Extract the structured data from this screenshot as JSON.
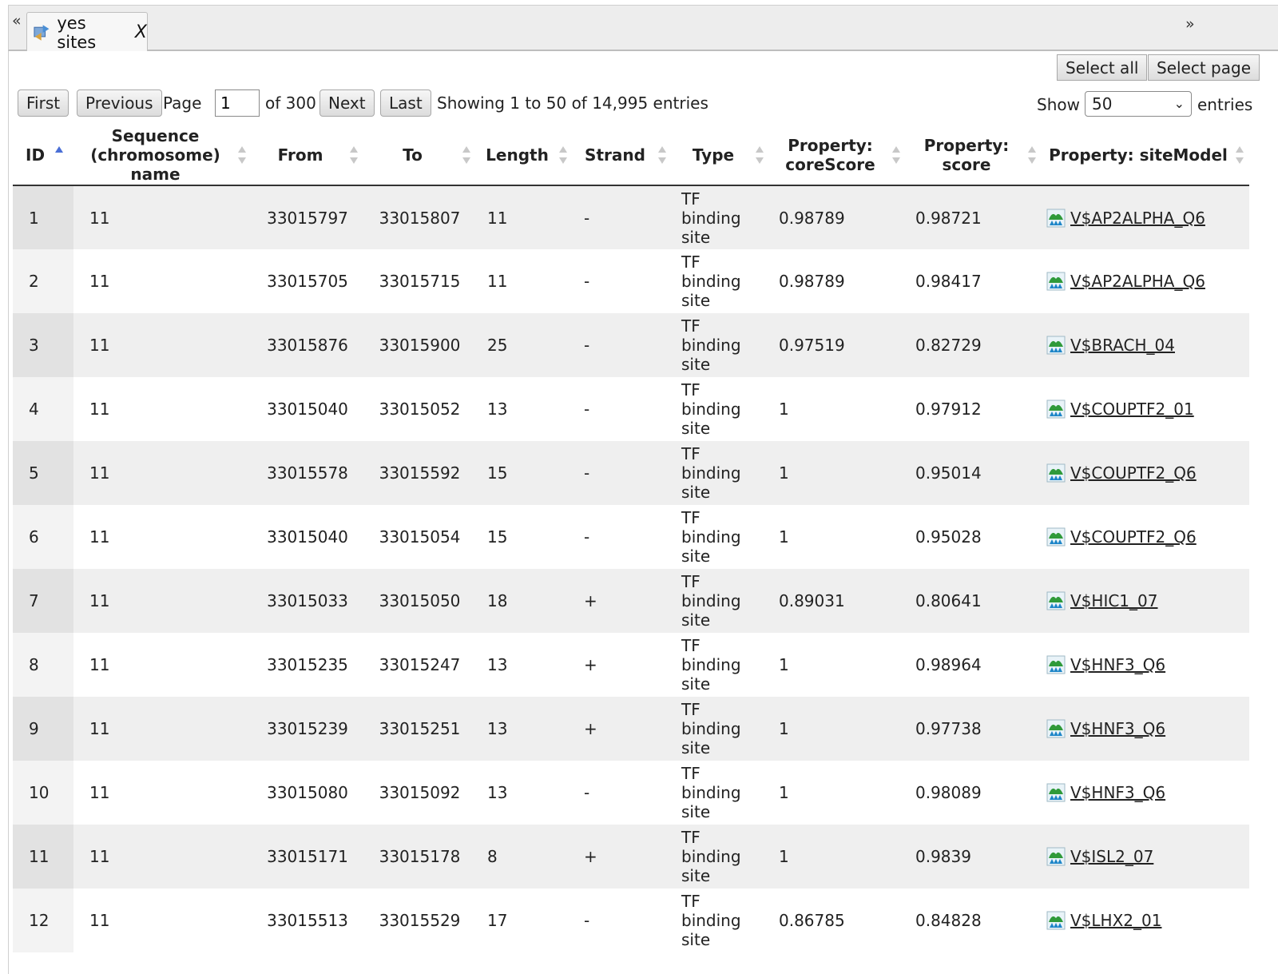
{
  "nav": {
    "collapse_left": "«",
    "collapse_right": "»"
  },
  "tab": {
    "label": "yes sites",
    "close": "X"
  },
  "toolbar": {
    "select_all": "Select all",
    "select_page": "Select page"
  },
  "pager": {
    "first": "First",
    "previous": "Previous",
    "page_label": "Page",
    "page_value": "1",
    "of_label": "of 300",
    "next": "Next",
    "last": "Last",
    "info": "Showing 1 to 50 of 14,995 entries"
  },
  "show": {
    "label": "Show",
    "value": "50",
    "suffix": "entries"
  },
  "table": {
    "columns": [
      "ID",
      "Sequence (chromosome) name",
      "From",
      "To",
      "Length",
      "Strand",
      "Type",
      "Property: coreScore",
      "Property: score",
      "Property: siteModel"
    ],
    "rows": [
      [
        "1",
        "11",
        "33015797",
        "33015807",
        "11",
        "-",
        "TF binding site",
        "0.98789",
        "0.98721",
        "V$AP2ALPHA_Q6"
      ],
      [
        "2",
        "11",
        "33015705",
        "33015715",
        "11",
        "-",
        "TF binding site",
        "0.98789",
        "0.98417",
        "V$AP2ALPHA_Q6"
      ],
      [
        "3",
        "11",
        "33015876",
        "33015900",
        "25",
        "-",
        "TF binding site",
        "0.97519",
        "0.82729",
        "V$BRACH_04"
      ],
      [
        "4",
        "11",
        "33015040",
        "33015052",
        "13",
        "-",
        "TF binding site",
        "1",
        "0.97912",
        "V$COUPTF2_01"
      ],
      [
        "5",
        "11",
        "33015578",
        "33015592",
        "15",
        "-",
        "TF binding site",
        "1",
        "0.95014",
        "V$COUPTF2_Q6"
      ],
      [
        "6",
        "11",
        "33015040",
        "33015054",
        "15",
        "-",
        "TF binding site",
        "1",
        "0.95028",
        "V$COUPTF2_Q6"
      ],
      [
        "7",
        "11",
        "33015033",
        "33015050",
        "18",
        "+",
        "TF binding site",
        "0.89031",
        "0.80641",
        "V$HIC1_07"
      ],
      [
        "8",
        "11",
        "33015235",
        "33015247",
        "13",
        "+",
        "TF binding site",
        "1",
        "0.98964",
        "V$HNF3_Q6"
      ],
      [
        "9",
        "11",
        "33015239",
        "33015251",
        "13",
        "+",
        "TF binding site",
        "1",
        "0.97738",
        "V$HNF3_Q6"
      ],
      [
        "10",
        "11",
        "33015080",
        "33015092",
        "13",
        "-",
        "TF binding site",
        "1",
        "0.98089",
        "V$HNF3_Q6"
      ],
      [
        "11",
        "11",
        "33015171",
        "33015178",
        "8",
        "+",
        "TF binding site",
        "1",
        "0.9839",
        "V$ISL2_07"
      ],
      [
        "12",
        "11",
        "33015513",
        "33015529",
        "17",
        "-",
        "TF binding site",
        "0.86785",
        "0.84828",
        "V$LHX2_01"
      ]
    ]
  },
  "icons": {
    "tab": "table-arrows-icon",
    "site_model": "matrix-logo-icon",
    "sort": "sort-arrows-icon"
  },
  "colors": {
    "sort_active": "#4a6fd6",
    "sort_inactive": "#c8c8c8",
    "row_odd": "#efefef",
    "row_even": "#ffffff"
  }
}
